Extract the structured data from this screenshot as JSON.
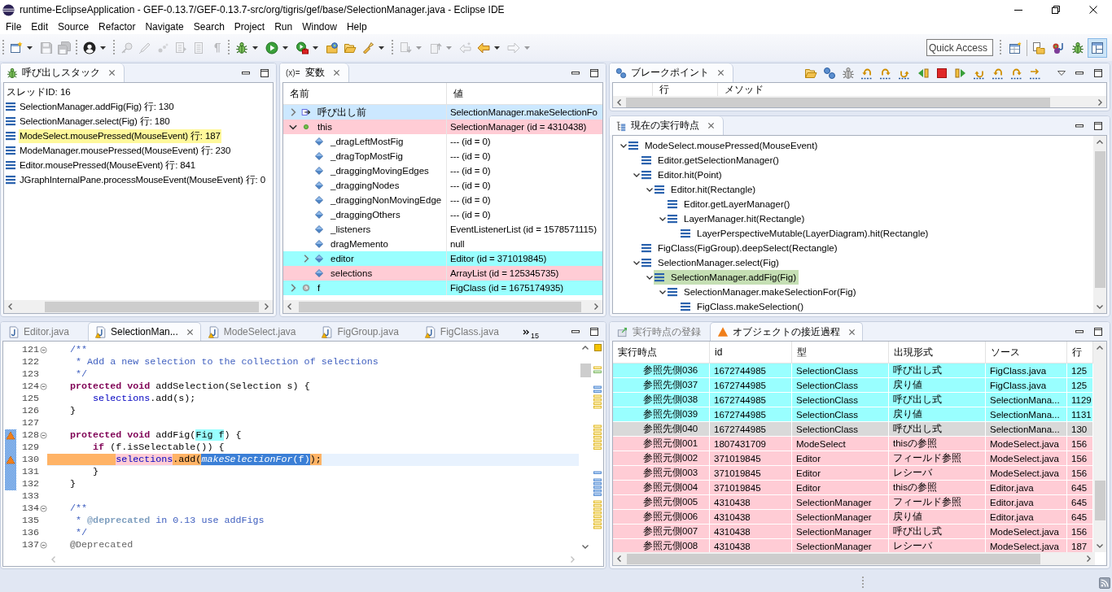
{
  "window": {
    "title": "runtime-EclipseApplication - GEF-0.13.7/GEF-0.13.7-src/org/tigris/gef/base/SelectionManager.java - Eclipse IDE"
  },
  "menu": [
    "File",
    "Edit",
    "Source",
    "Refactor",
    "Navigate",
    "Search",
    "Project",
    "Run",
    "Window",
    "Help"
  ],
  "toolbar": {
    "groups": [
      [
        {
          "kind": "new",
          "dropdown": true,
          "disabled": false
        },
        {
          "kind": "save",
          "dropdown": false,
          "disabled": true
        },
        {
          "kind": "saveall",
          "dropdown": false,
          "disabled": true
        }
      ],
      [
        {
          "kind": "profile",
          "dropdown": true,
          "disabled": false
        }
      ],
      [
        {
          "kind": "pin",
          "dropdown": false,
          "disabled": true
        },
        {
          "kind": "pen",
          "dropdown": false,
          "disabled": true
        },
        {
          "kind": "ink",
          "dropdown": false,
          "disabled": true
        },
        {
          "kind": "stack",
          "dropdown": false,
          "disabled": true
        },
        {
          "kind": "page",
          "dropdown": false,
          "disabled": true
        },
        {
          "kind": "pilcrow",
          "dropdown": false,
          "disabled": true
        }
      ],
      [
        {
          "kind": "debug",
          "dropdown": true,
          "disabled": false
        },
        {
          "kind": "run",
          "dropdown": true,
          "disabled": false
        },
        {
          "kind": "runtool",
          "dropdown": true,
          "disabled": false
        },
        {
          "kind": "opentype",
          "dropdown": false,
          "disabled": false
        },
        {
          "kind": "openfolder",
          "dropdown": false,
          "disabled": false
        },
        {
          "kind": "torch",
          "dropdown": true,
          "disabled": false
        }
      ],
      [
        {
          "kind": "nextmark",
          "dropdown": true,
          "disabled": true
        },
        {
          "kind": "prevmark",
          "dropdown": true,
          "disabled": true
        },
        {
          "kind": "lastedit",
          "dropdown": false,
          "disabled": true
        },
        {
          "kind": "back",
          "dropdown": true,
          "disabled": false
        },
        {
          "kind": "forward",
          "dropdown": true,
          "disabled": true
        }
      ]
    ],
    "quick_access": {
      "placeholder": "Quick Access"
    },
    "perspectives": [
      {
        "kind": "open",
        "selected": false
      },
      {
        "kind": "resource",
        "selected": false
      },
      {
        "kind": "plugin",
        "selected": false
      },
      {
        "kind": "debug",
        "selected": false
      },
      {
        "kind": "layout",
        "selected": true
      }
    ]
  },
  "call_stack": {
    "title": "呼び出しスタック",
    "thread": "スレッドID: 16",
    "frames": [
      {
        "label": "SelectionManager.addFig(Fig) 行: 130",
        "highlighted": false
      },
      {
        "label": "SelectionManager.select(Fig) 行: 180",
        "highlighted": false
      },
      {
        "label": "ModeSelect.mousePressed(MouseEvent) 行: 187",
        "highlighted": true
      },
      {
        "label": "ModeManager.mousePressed(MouseEvent) 行: 230",
        "highlighted": false
      },
      {
        "label": "Editor.mousePressed(MouseEvent) 行: 841",
        "highlighted": false
      },
      {
        "label": "JGraphInternalPane.processMouseEvent(MouseEvent) 行: 0",
        "highlighted": false
      }
    ]
  },
  "variables": {
    "icon_text": "(x)=",
    "title": "変数",
    "columns": [
      "名前",
      "値"
    ],
    "rows": [
      {
        "name": "呼び出し前",
        "value": "SelectionManager.makeSelectionFo",
        "kind": "return",
        "expanded": false,
        "selected": true
      },
      {
        "name": "this",
        "value": "SelectionManager (id = 4310438)",
        "kind": "object",
        "expanded": true,
        "selected": false,
        "color": "#ffccd5",
        "children": [
          {
            "name": "_dragLeftMostFig",
            "value": "--- (id = 0)",
            "kind": "field",
            "selected": false
          },
          {
            "name": "_dragTopMostFig",
            "value": "--- (id = 0)",
            "kind": "field",
            "selected": false
          },
          {
            "name": "_draggingMovingEdges",
            "value": "--- (id = 0)",
            "kind": "field",
            "selected": false
          },
          {
            "name": "_draggingNodes",
            "value": "--- (id = 0)",
            "kind": "field",
            "selected": false
          },
          {
            "name": "_draggingNonMovingEdge",
            "value": "--- (id = 0)",
            "kind": "field",
            "selected": false
          },
          {
            "name": "_draggingOthers",
            "value": "--- (id = 0)",
            "kind": "field",
            "selected": false
          },
          {
            "name": "_listeners",
            "value": "EventListenerList (id = 1578571115)",
            "kind": "field",
            "selected": false
          },
          {
            "name": "dragMemento",
            "value": "null",
            "kind": "field",
            "selected": false
          },
          {
            "name": "editor",
            "value": "Editor (id = 371019845)",
            "kind": "field",
            "expanded": false,
            "selected": false,
            "color": "#99ffff"
          },
          {
            "name": "selections",
            "value": "ArrayList (id = 125345735)",
            "kind": "field",
            "selected": false,
            "color": "#ffccd5"
          }
        ]
      },
      {
        "name": "f",
        "value": "FigClass (id = 1675174935)",
        "kind": "local",
        "expanded": false,
        "selected": false,
        "color": "#99ffff"
      }
    ]
  },
  "breakpoints": {
    "title": "ブレークポイント",
    "columns": [
      "行",
      "メソッド"
    ]
  },
  "execution_point": {
    "title": "現在の実行時点",
    "tree": [
      {
        "label": "ModeSelect.mousePressed(MouseEvent)",
        "expanded": true,
        "selected": false,
        "children": [
          {
            "label": "Editor.getSelectionManager()",
            "selected": false
          },
          {
            "label": "Editor.hit(Point)",
            "expanded": true,
            "selected": false,
            "children": [
              {
                "label": "Editor.hit(Rectangle)",
                "expanded": true,
                "selected": false,
                "children": [
                  {
                    "label": "Editor.getLayerManager()",
                    "selected": false
                  },
                  {
                    "label": "LayerManager.hit(Rectangle)",
                    "expanded": true,
                    "selected": false,
                    "children": [
                      {
                        "label": "LayerPerspectiveMutable(LayerDiagram).hit(Rectangle)",
                        "selected": false
                      }
                    ]
                  }
                ]
              }
            ]
          },
          {
            "label": "FigClass(FigGroup).deepSelect(Rectangle)",
            "selected": false
          },
          {
            "label": "SelectionManager.select(Fig)",
            "expanded": true,
            "selected": false,
            "children": [
              {
                "label": "SelectionManager.addFig(Fig)",
                "expanded": true,
                "selected": true,
                "children": [
                  {
                    "label": "SelectionManager.makeSelectionFor(Fig)",
                    "expanded": true,
                    "selected": false,
                    "children": [
                      {
                        "label": "FigClass.makeSelection()",
                        "selected": false
                      }
                    ]
                  }
                ]
              }
            ]
          }
        ]
      }
    ]
  },
  "editor": {
    "tabs": [
      {
        "label": "Editor.java",
        "selected": false,
        "warning": false
      },
      {
        "label": "SelectionMan...",
        "selected": true,
        "warning": true
      },
      {
        "label": "ModeSelect.java",
        "selected": false,
        "warning": true
      },
      {
        "label": "FigGroup.java",
        "selected": false,
        "warning": true
      },
      {
        "label": "FigClass.java",
        "selected": false,
        "warning": true
      }
    ],
    "hidden_tabs": "15",
    "blocks": [
      {
        "ranged": false,
        "lines": [
          {
            "number": "121",
            "fold": true,
            "arrow": false,
            "current": false,
            "tokens": [
              {
                "text": "    /**",
                "kind": "comment"
              }
            ]
          },
          {
            "number": "122",
            "fold": false,
            "arrow": false,
            "current": false,
            "tokens": [
              {
                "text": "     * Add a new selection to the collection of selections",
                "kind": "comment"
              }
            ]
          },
          {
            "number": "123",
            "fold": false,
            "arrow": false,
            "current": false,
            "tokens": [
              {
                "text": "     */",
                "kind": "comment"
              }
            ]
          },
          {
            "number": "124",
            "fold": true,
            "arrow": false,
            "current": false,
            "tokens": [
              {
                "text": "    protected",
                "kind": "keyword"
              },
              {
                "text": " void",
                "kind": "keyword"
              },
              {
                "text": " addSelection(Selection s) {",
                "kind": "plain"
              }
            ]
          },
          {
            "number": "125",
            "fold": false,
            "arrow": false,
            "current": false,
            "tokens": [
              {
                "text": "        selections",
                "kind": "field"
              },
              {
                "text": ".add(s);",
                "kind": "plain"
              }
            ]
          },
          {
            "number": "126",
            "fold": false,
            "arrow": false,
            "current": false,
            "tokens": [
              {
                "text": "    }",
                "kind": "plain"
              }
            ]
          },
          {
            "number": "127",
            "fold": false,
            "arrow": false,
            "current": false
          }
        ]
      },
      {
        "ranged": true,
        "lines": [
          {
            "number": "128",
            "fold": true,
            "arrow": true,
            "current": false,
            "tokens": [
              {
                "text": "    protected",
                "kind": "keyword"
              },
              {
                "text": " void",
                "kind": "keyword"
              },
              {
                "text": " addFig(",
                "kind": "plain"
              },
              {
                "text": "Fig f",
                "kind": "plain",
                "color": "#99ffff"
              },
              {
                "text": ") {",
                "kind": "plain"
              }
            ]
          },
          {
            "number": "129",
            "fold": false,
            "arrow": false,
            "current": false,
            "tokens": [
              {
                "text": "        if",
                "kind": "keyword"
              },
              {
                "text": " (f.isSelectable()) {",
                "kind": "plain"
              }
            ]
          },
          {
            "number": "130",
            "fold": false,
            "arrow": true,
            "current": true,
            "tokens": [
              {
                "text": "            selections",
                "kind": "field",
                "color": "#ffccd5"
              },
              {
                "text": ".add(",
                "kind": "plain"
              },
              {
                "text": "makeSelectionFor",
                "kind": "call",
                "color": "#3b7fd6"
              },
              {
                "text": "(f)",
                "kind": "plain",
                "color": "#3b7fd6"
              },
              {
                "text": ");",
                "kind": "plain"
              }
            ]
          },
          {
            "number": "131",
            "fold": false,
            "arrow": false,
            "current": false,
            "tokens": [
              {
                "text": "        }",
                "kind": "plain"
              }
            ]
          },
          {
            "number": "132",
            "fold": false,
            "arrow": false,
            "current": false,
            "tokens": [
              {
                "text": "    }",
                "kind": "plain"
              }
            ]
          }
        ]
      },
      {
        "ranged": false,
        "lines": [
          {
            "number": "133",
            "fold": false,
            "arrow": false,
            "current": false
          },
          {
            "number": "134",
            "fold": true,
            "arrow": false,
            "current": false,
            "tokens": [
              {
                "text": "    /**",
                "kind": "comment"
              }
            ]
          },
          {
            "number": "135",
            "fold": false,
            "arrow": false,
            "current": false,
            "tokens": [
              {
                "text": "     *",
                "kind": "comment"
              },
              {
                "text": " @deprecated",
                "kind": "tag"
              },
              {
                "text": " in 0.13 use addFigs",
                "kind": "comment"
              }
            ]
          },
          {
            "number": "136",
            "fold": false,
            "arrow": false,
            "current": false,
            "tokens": [
              {
                "text": "     */",
                "kind": "comment"
              }
            ]
          },
          {
            "number": "137",
            "fold": true,
            "arrow": false,
            "current": false,
            "tokens": [
              {
                "text": "    @Deprecated",
                "kind": "annotation"
              }
            ]
          }
        ]
      }
    ]
  },
  "access_trace": {
    "tabs": [
      {
        "label": "実行時点の登録",
        "selected": false,
        "kind": "register"
      },
      {
        "label": "オブジェクトの接近過程",
        "selected": true,
        "kind": "trace"
      }
    ],
    "columns": [
      "実行時点",
      "id",
      "型",
      "出現形式",
      "ソース",
      "行"
    ],
    "rows": [
      {
        "cells": [
          "参照先側036",
          "1672744985",
          "SelectionClass",
          "呼び出し式",
          "FigClass.java",
          "125"
        ],
        "color": "#99ffff",
        "selected": false
      },
      {
        "cells": [
          "参照先側037",
          "1672744985",
          "SelectionClass",
          "戻り値",
          "FigClass.java",
          "125"
        ],
        "color": "#99ffff",
        "selected": false
      },
      {
        "cells": [
          "参照先側038",
          "1672744985",
          "SelectionClass",
          "呼び出し式",
          "SelectionMana...",
          "1129"
        ],
        "color": "#99ffff",
        "selected": false
      },
      {
        "cells": [
          "参照先側039",
          "1672744985",
          "SelectionClass",
          "戻り値",
          "SelectionMana...",
          "1131"
        ],
        "color": "#99ffff",
        "selected": false
      },
      {
        "cells": [
          "参照先側040",
          "1672744985",
          "SelectionClass",
          "呼び出し式",
          "SelectionMana...",
          "130"
        ],
        "selected": true
      },
      {
        "cells": [
          "参照元側001",
          "1807431709",
          "ModeSelect",
          "thisの参照",
          "ModeSelect.java",
          "156"
        ],
        "color": "#ffccd5",
        "selected": false
      },
      {
        "cells": [
          "参照元側002",
          "371019845",
          "Editor",
          "フィールド参照",
          "ModeSelect.java",
          "156"
        ],
        "color": "#ffccd5",
        "selected": false
      },
      {
        "cells": [
          "参照元側003",
          "371019845",
          "Editor",
          "レシーバ",
          "ModeSelect.java",
          "156"
        ],
        "color": "#ffccd5",
        "selected": false
      },
      {
        "cells": [
          "参照元側004",
          "371019845",
          "Editor",
          "thisの参照",
          "Editor.java",
          "645"
        ],
        "color": "#ffccd5",
        "selected": false
      },
      {
        "cells": [
          "参照元側005",
          "4310438",
          "SelectionManager",
          "フィールド参照",
          "Editor.java",
          "645"
        ],
        "color": "#ffccd5",
        "selected": false
      },
      {
        "cells": [
          "参照元側006",
          "4310438",
          "SelectionManager",
          "戻り値",
          "Editor.java",
          "645"
        ],
        "color": "#ffccd5",
        "selected": false
      },
      {
        "cells": [
          "参照元側007",
          "4310438",
          "SelectionManager",
          "呼び出し式",
          "ModeSelect.java",
          "156"
        ],
        "color": "#ffccd5",
        "selected": false
      },
      {
        "cells": [
          "参照元側008",
          "4310438",
          "SelectionManager",
          "レシーバ",
          "ModeSelect.java",
          "187"
        ],
        "color": "#ffccd5",
        "selected": false
      }
    ]
  }
}
